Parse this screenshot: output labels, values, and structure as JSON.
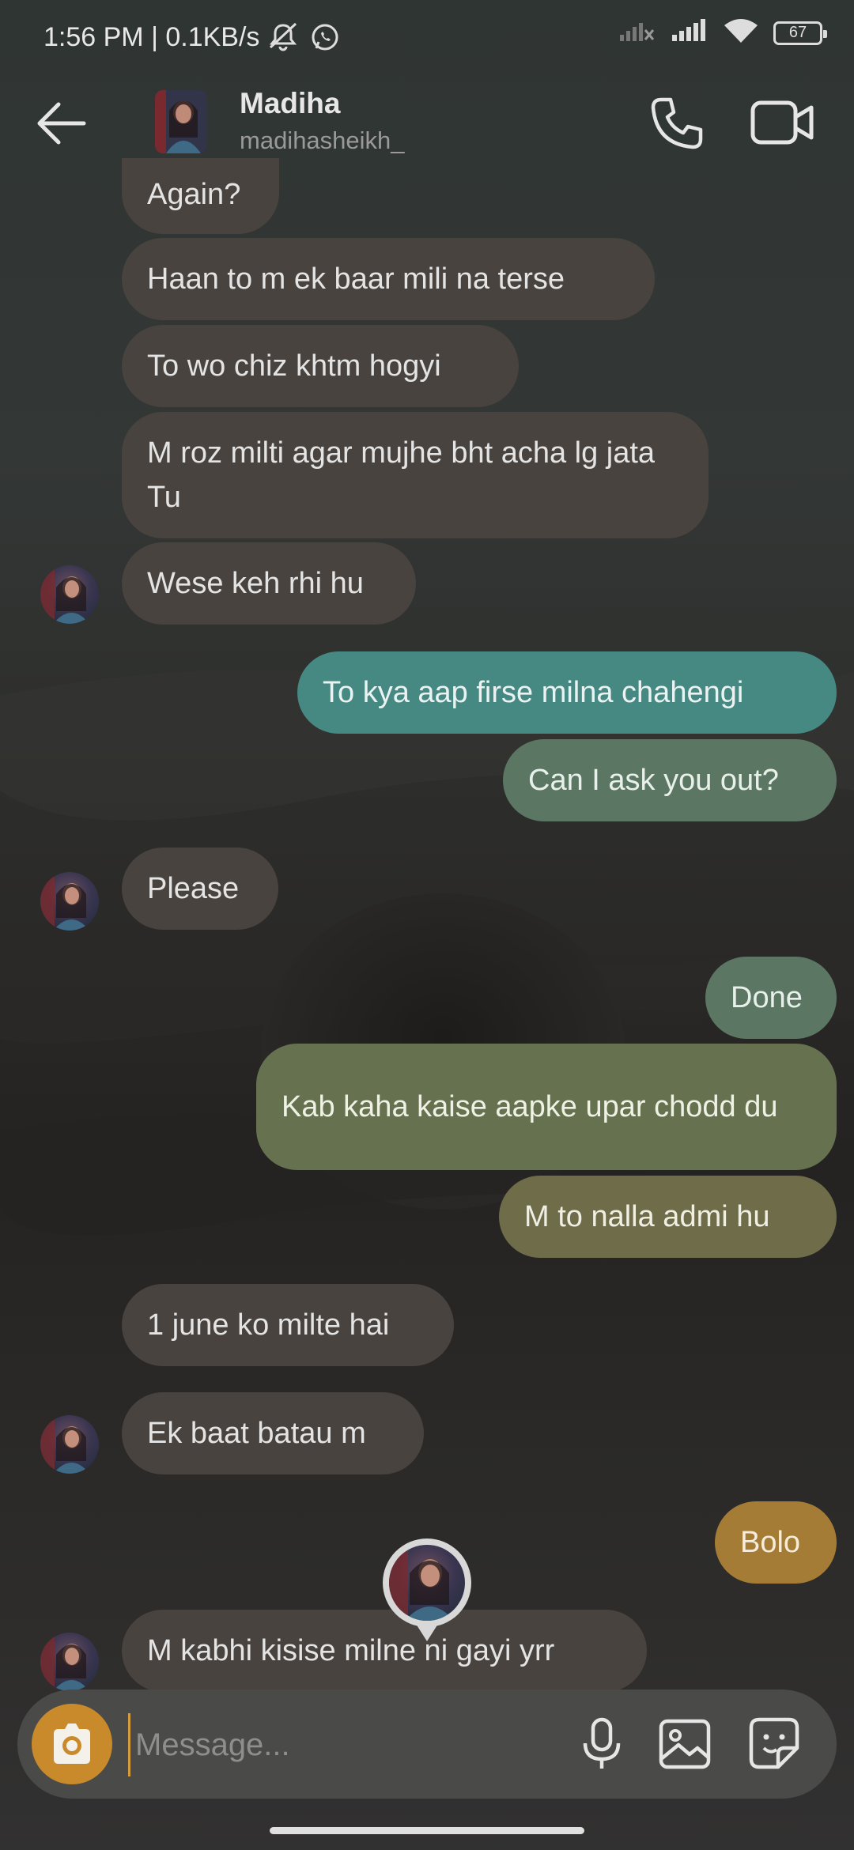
{
  "status_bar": {
    "time_speed": "1:56 PM | 0.1KB/s",
    "battery": "67"
  },
  "header": {
    "name": "Madiha",
    "username": "madihasheikh_"
  },
  "messages": [
    {
      "side": "in",
      "text": "Again?"
    },
    {
      "side": "in",
      "text": "Haan to m ek baar mili na terse"
    },
    {
      "side": "in",
      "text": "To wo chiz khtm hogyi"
    },
    {
      "side": "in",
      "text": "M roz milti agar mujhe bht acha lg jata Tu"
    },
    {
      "side": "in",
      "text": "Wese keh rhi hu"
    },
    {
      "side": "out",
      "text": "To kya aap firse milna chahengi"
    },
    {
      "side": "out",
      "text": "Can I ask you out?"
    },
    {
      "side": "in",
      "text": "Please"
    },
    {
      "side": "out",
      "text": "Done"
    },
    {
      "side": "out",
      "text": "Kab kaha kaise aapke upar chodd du"
    },
    {
      "side": "out",
      "text": "M to nalla admi hu"
    },
    {
      "side": "in",
      "text": "1 june ko milte hai"
    },
    {
      "side": "in",
      "text": "Ek baat batau m"
    },
    {
      "side": "out",
      "text": "Bolo"
    },
    {
      "side": "in",
      "text": "M kabhi kisise milne ni gayi yrr"
    }
  ],
  "composer": {
    "placeholder": "Message..."
  },
  "icons": {
    "back": "arrow-left-icon",
    "call": "phone-icon",
    "video": "video-camera-icon",
    "camera": "camera-icon",
    "mic": "microphone-icon",
    "gallery": "image-icon",
    "sticker": "sticker-icon"
  },
  "colors": {
    "incoming_bubble": "#48433e",
    "outgoing_top": "#468882",
    "outgoing_bottom": "#a47c36",
    "camera_button": "#c98a2c"
  }
}
